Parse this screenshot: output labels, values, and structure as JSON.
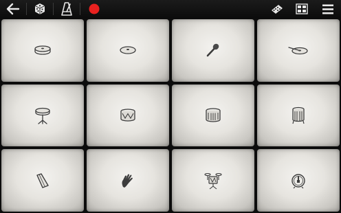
{
  "toolbar": {
    "left_icons": [
      "back-arrow-icon",
      "dice-icon",
      "metronome-icon",
      "record-icon"
    ],
    "right_icons": [
      "drum-kit-icon",
      "kit-selector-icon",
      "menu-icon"
    ],
    "record_color": "#e8211f"
  },
  "pads": [
    {
      "instrument": "hi-hat-cymbal-icon"
    },
    {
      "instrument": "crash-cymbal-icon"
    },
    {
      "instrument": "maraca-icon"
    },
    {
      "instrument": "ride-cymbal-icon"
    },
    {
      "instrument": "hi-hat-stand-icon"
    },
    {
      "instrument": "snare-drum-icon"
    },
    {
      "instrument": "tom-drum-icon"
    },
    {
      "instrument": "floor-tom-icon"
    },
    {
      "instrument": "cowbell-icon"
    },
    {
      "instrument": "hand-clap-icon"
    },
    {
      "instrument": "drum-kit-icon"
    },
    {
      "instrument": "bass-drum-icon"
    }
  ],
  "colors": {
    "pad_center": "#f3f2ef",
    "pad_edge": "#a9a7a2",
    "icon_stroke": "#3c3c3c",
    "background": "#0c0c0c"
  }
}
